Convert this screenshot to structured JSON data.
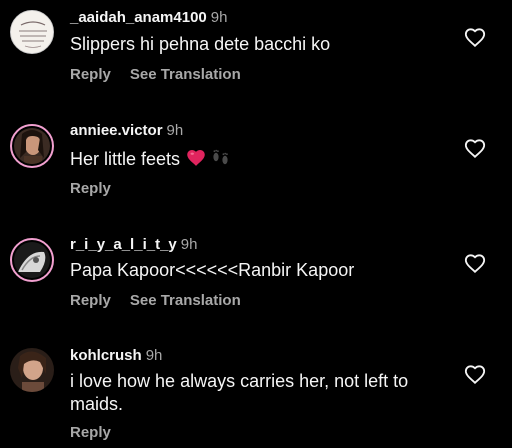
{
  "comments": [
    {
      "username": "_aaidah_anam4100",
      "time": "9h",
      "text": "Slippers hi pehna dete bacchi ko",
      "reply": "Reply",
      "translate": "See Translation"
    },
    {
      "username": "anniee.victor",
      "time": "9h",
      "text": "Her little feets",
      "emoji": [
        "red-heart",
        "footprints"
      ],
      "reply": "Reply"
    },
    {
      "username": "r_i_y_a_l_i_t_y",
      "time": "9h",
      "text": "Papa Kapoor<<<<<<Ranbir Kapoor",
      "reply": "Reply",
      "translate": "See Translation"
    },
    {
      "username": "kohlcrush",
      "time": "9h",
      "text": "i love how he always carries her, not left to maids.",
      "reply": "Reply"
    }
  ],
  "colors": {
    "background": "#000000",
    "primary_text": "#f5f5f5",
    "secondary_text": "#a8a8a8",
    "story_ring": "#f2a0d0",
    "heart_emoji": "#e0245e"
  }
}
